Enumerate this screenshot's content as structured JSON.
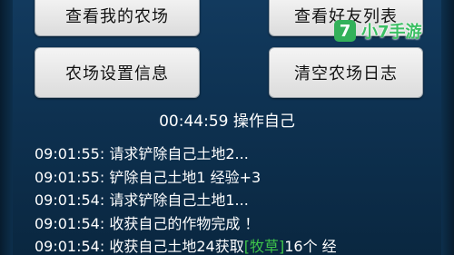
{
  "buttons": {
    "my_farm": "查看我的农场",
    "friends_list": "查看好友列表",
    "farm_settings": "农场设置信息",
    "clear_log": "清空农场日志"
  },
  "status": "00:44:59 操作自己",
  "log": [
    {
      "text": "09:01:55: 请求铲除自己土地2..."
    },
    {
      "text": "09:01:55: 铲除自己土地1 经验+3"
    },
    {
      "text": "09:01:54: 请求铲除自己土地1..."
    },
    {
      "text": "09:01:54: 收获自己的作物完成 ！"
    },
    {
      "pre": "09:01:54: 收获自己土地24获取",
      "highlight": "[牧草]",
      "post": "16个 经"
    }
  ],
  "watermark": {
    "logo": "7",
    "text": "小7手游"
  },
  "colors": {
    "background": "#0e3252",
    "button": "#e8e8e8",
    "highlight": "#3ec44a",
    "watermark": "#3bbf63"
  }
}
